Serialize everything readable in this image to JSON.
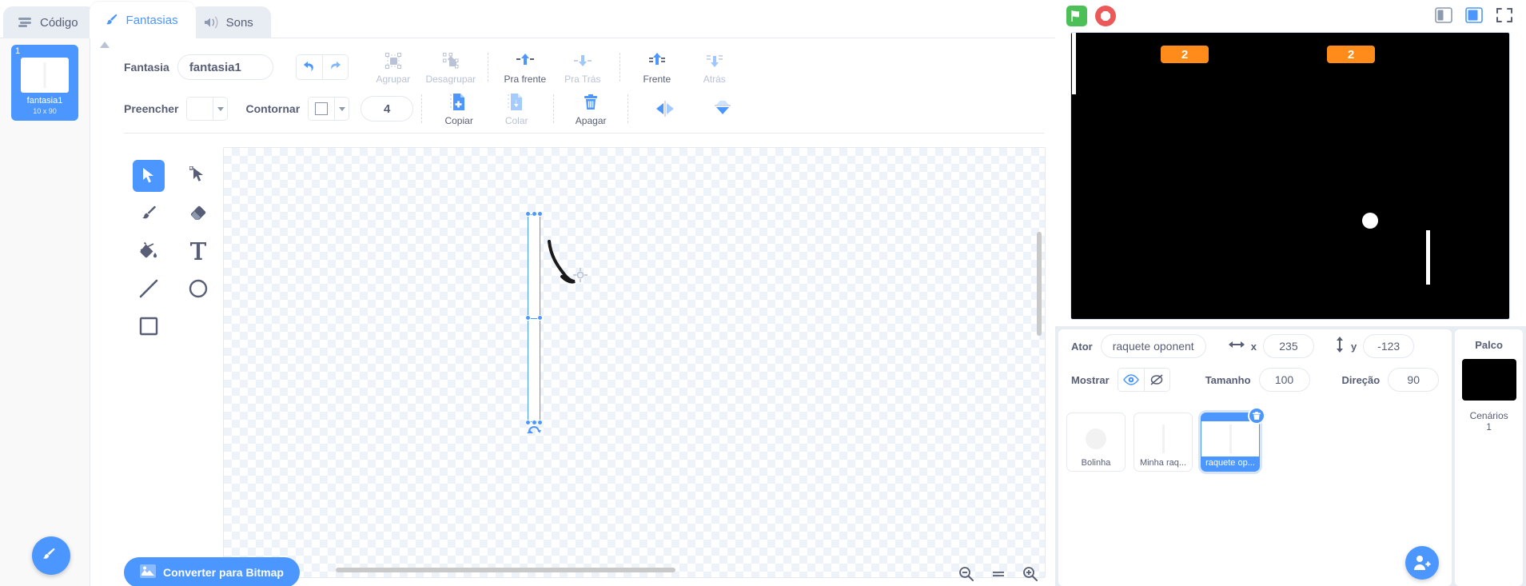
{
  "tabs": [
    {
      "label": "Código",
      "icon": "code-icon",
      "active": false
    },
    {
      "label": "Fantasias",
      "icon": "paintbrush-icon",
      "active": true
    },
    {
      "label": "Sons",
      "icon": "speaker-icon",
      "active": false
    }
  ],
  "costume_list": [
    {
      "number": "1",
      "name": "fantasia1",
      "size": "10 x 90"
    }
  ],
  "paint_toolbar": {
    "costume_label": "Fantasia",
    "costume_name": "fantasia1",
    "undo_icon": "undo-icon",
    "redo_icon": "redo-icon",
    "group_label": "Agrupar",
    "ungroup_label": "Desagrupar",
    "forward_label": "Pra frente",
    "backward_label": "Pra Trás",
    "front_label": "Frente",
    "back_label": "Atrás",
    "fill_label": "Preencher",
    "outline_label": "Contornar",
    "stroke_width": "4",
    "copy_label": "Copiar",
    "paste_label": "Colar",
    "delete_label": "Apagar",
    "flip_horizontal_icon": "flip-horizontal-icon",
    "flip_vertical_icon": "flip-vertical-icon"
  },
  "tools": [
    {
      "name": "select-tool",
      "icon": "arrow-cursor-icon",
      "selected": true
    },
    {
      "name": "reshape-tool",
      "icon": "reshape-icon",
      "selected": false
    },
    {
      "name": "brush-tool",
      "icon": "paintbrush-icon",
      "selected": false
    },
    {
      "name": "eraser-tool",
      "icon": "eraser-icon",
      "selected": false
    },
    {
      "name": "fill-tool",
      "icon": "paint-bucket-icon",
      "selected": false
    },
    {
      "name": "text-tool",
      "icon": "text-icon",
      "selected": false
    },
    {
      "name": "line-tool",
      "icon": "line-icon",
      "selected": false
    },
    {
      "name": "circle-tool",
      "icon": "circle-icon",
      "selected": false
    },
    {
      "name": "rectangle-tool",
      "icon": "square-icon",
      "selected": false
    }
  ],
  "canvas_footer": {
    "convert_label": "Converter para Bitmap",
    "zoom_out": "−",
    "zoom_reset": "=",
    "zoom_in": "+"
  },
  "stage_controls": {
    "green_flag_icon": "green-flag-icon",
    "stop_icon": "stop-icon",
    "small_stage_icon": "small-stage-icon",
    "large_stage_icon": "large-stage-icon",
    "fullscreen_icon": "fullscreen-icon"
  },
  "stage": {
    "background_color": "#000000",
    "score_left": "2",
    "score_right": "2"
  },
  "sprite_info": {
    "sprite_label": "Ator",
    "sprite_name": "raquete oponente",
    "x_label": "x",
    "x_value": "235",
    "y_label": "y",
    "y_value": "-123",
    "show_label": "Mostrar",
    "size_label": "Tamanho",
    "size_value": "100",
    "direction_label": "Direção",
    "direction_value": "90"
  },
  "sprites": [
    {
      "name": "Bolinha",
      "thumb": "ball",
      "selected": false
    },
    {
      "name": "Minha raq...",
      "thumb": "paddle",
      "selected": false
    },
    {
      "name": "raquete op...",
      "thumb": "paddle",
      "selected": true
    }
  ],
  "stage_panel": {
    "title": "Palco",
    "backdrops_label": "Cenários",
    "backdrops_count": "1"
  },
  "colors": {
    "accent": "#4c97ff",
    "orange": "#ff8c1a",
    "green": "#4cbf56",
    "red": "#ec5959",
    "text": "#575e75"
  }
}
